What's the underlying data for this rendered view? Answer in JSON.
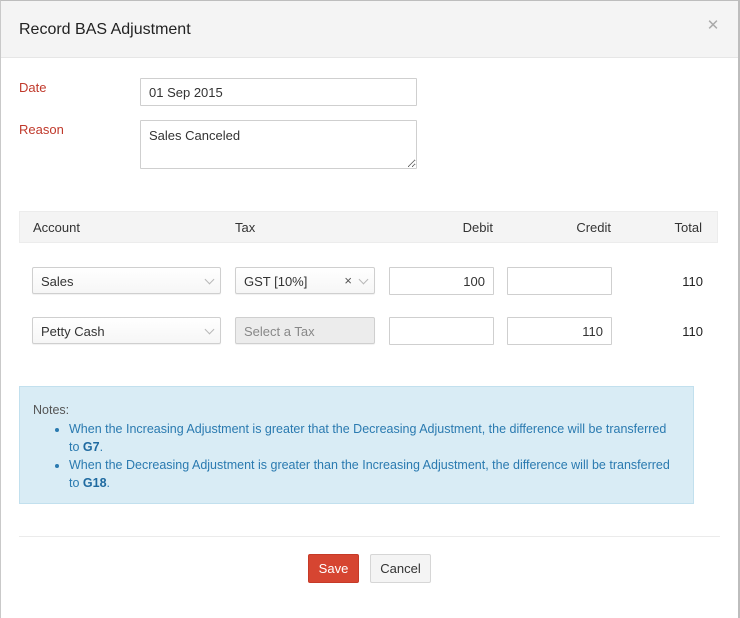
{
  "modal": {
    "title": "Record BAS Adjustment",
    "close_icon": "close-icon"
  },
  "form": {
    "date_label": "Date",
    "date_value": "01 Sep 2015",
    "reason_label": "Reason",
    "reason_value": "Sales Canceled"
  },
  "table": {
    "headers": [
      "Account",
      "Tax",
      "Debit",
      "Credit",
      "Total"
    ],
    "rows": [
      {
        "account": "Sales",
        "tax": "GST [10%]",
        "tax_placeholder": "",
        "tax_clearable": true,
        "tax_disabled": false,
        "debit": "100",
        "credit": "",
        "total": "110"
      },
      {
        "account": "Petty Cash",
        "tax": "",
        "tax_placeholder": "Select a Tax",
        "tax_clearable": false,
        "tax_disabled": true,
        "debit": "",
        "credit": "110",
        "total": "110"
      }
    ]
  },
  "notes": {
    "title": "Notes:",
    "items": [
      {
        "text": "When the Increasing Adjustment is greater that the Decreasing Adjustment, the difference will be transferred to ",
        "bold": "G7",
        "suffix": "."
      },
      {
        "text": "When the Decreasing Adjustment is greater than the Increasing Adjustment, the difference will be transferred to ",
        "bold": "G18",
        "suffix": "."
      }
    ]
  },
  "footer": {
    "save_label": "Save",
    "cancel_label": "Cancel"
  },
  "colors": {
    "label_red": "#c0392b",
    "save_button": "#d64531",
    "notes_bg": "#d9ecf5",
    "notes_text": "#2a7ab0"
  }
}
